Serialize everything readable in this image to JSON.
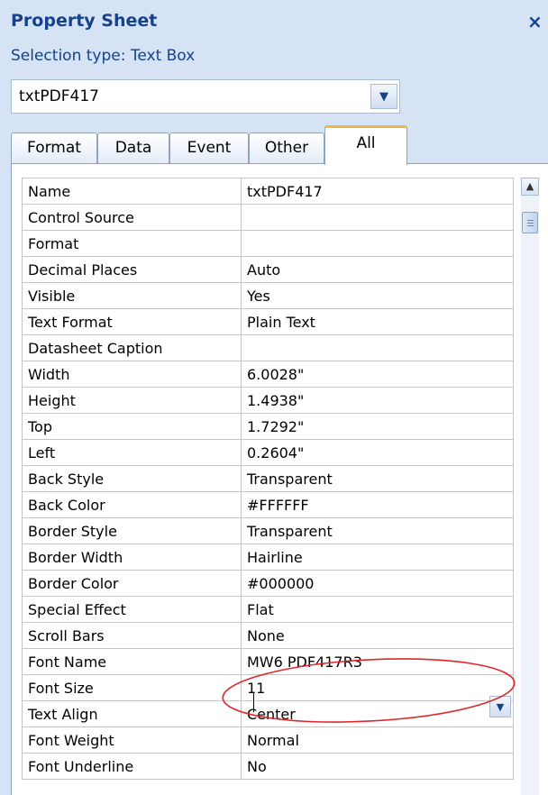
{
  "title": "Property Sheet",
  "close_glyph": "×",
  "selection_type": "Selection type:  Text Box",
  "selected_control": "txtPDF417",
  "tabs": [
    {
      "label": "Format",
      "active": false
    },
    {
      "label": "Data",
      "active": false
    },
    {
      "label": "Event",
      "active": false
    },
    {
      "label": "Other",
      "active": false
    },
    {
      "label": "All",
      "active": true
    }
  ],
  "properties": [
    {
      "name": "Name",
      "value": "txtPDF417"
    },
    {
      "name": "Control Source",
      "value": ""
    },
    {
      "name": "Format",
      "value": ""
    },
    {
      "name": "Decimal Places",
      "value": "Auto"
    },
    {
      "name": "Visible",
      "value": "Yes"
    },
    {
      "name": "Text Format",
      "value": "Plain Text"
    },
    {
      "name": "Datasheet Caption",
      "value": ""
    },
    {
      "name": "Width",
      "value": "6.0028\""
    },
    {
      "name": "Height",
      "value": "1.4938\""
    },
    {
      "name": "Top",
      "value": "1.7292\""
    },
    {
      "name": "Left",
      "value": "0.2604\""
    },
    {
      "name": "Back Style",
      "value": "Transparent"
    },
    {
      "name": "Back Color",
      "value": "#FFFFFF"
    },
    {
      "name": "Border Style",
      "value": "Transparent"
    },
    {
      "name": "Border Width",
      "value": "Hairline"
    },
    {
      "name": "Border Color",
      "value": "#000000"
    },
    {
      "name": "Special Effect",
      "value": "Flat"
    },
    {
      "name": "Scroll Bars",
      "value": "None"
    },
    {
      "name": "Font Name",
      "value": "MW6 PDF417R3"
    },
    {
      "name": "Font Size",
      "value": "11"
    },
    {
      "name": "Text Align",
      "value": "Center"
    },
    {
      "name": "Font Weight",
      "value": "Normal"
    },
    {
      "name": "Font Underline",
      "value": "No"
    }
  ],
  "icons": {
    "combo_dropdown": "chevron-down-icon",
    "scroll_up": "arrow-up-icon",
    "value_dropdown": "chevron-down-icon"
  },
  "colors": {
    "title_text": "#15428b",
    "panel_bg": "#d5e3f4",
    "active_tab_accent": "#f4b343",
    "annotation_ellipse": "#e0262b"
  }
}
